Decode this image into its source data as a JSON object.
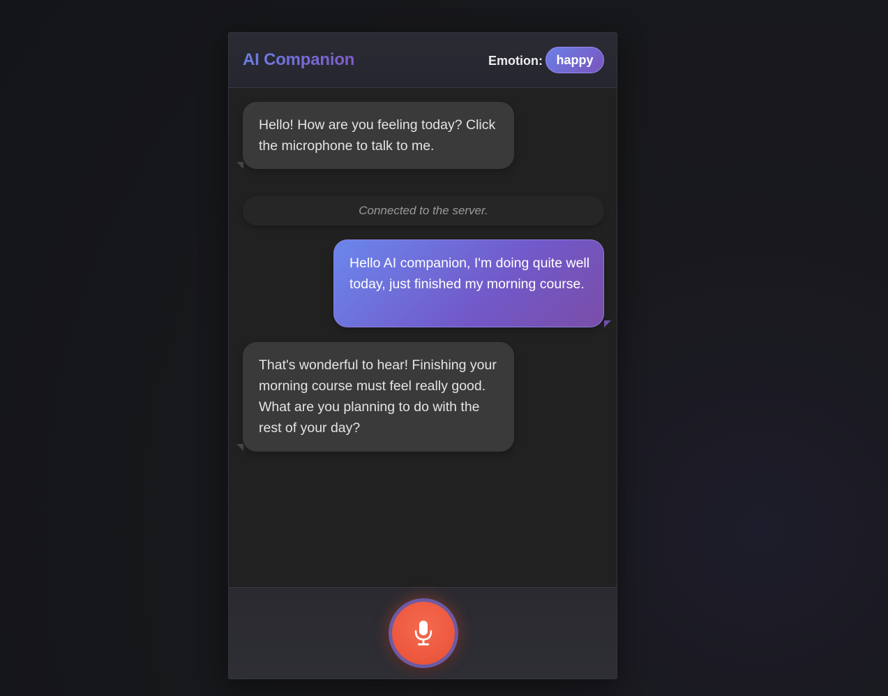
{
  "header": {
    "title": "AI Companion",
    "emotion_label": "Emotion:",
    "emotion_value": "happy"
  },
  "messages": [
    {
      "role": "ai",
      "text": "Hello! How are you feeling today? Click the microphone to talk to me."
    },
    {
      "role": "status",
      "text": "Connected to the server."
    },
    {
      "role": "user",
      "text": "Hello AI companion, I'm doing quite well today, just finished my morning course."
    },
    {
      "role": "ai",
      "text": "That's wonderful to hear! Finishing your morning course must feel really good. What are you planning to do with the rest of your day?"
    }
  ],
  "footer": {
    "mic_icon": "microphone-icon"
  },
  "colors": {
    "accent_start": "#6b7fe6",
    "accent_end": "#7d5cc6",
    "mic_button": "#ee5a40",
    "ai_bubble": "#3a3a3a",
    "background": "#212121"
  }
}
